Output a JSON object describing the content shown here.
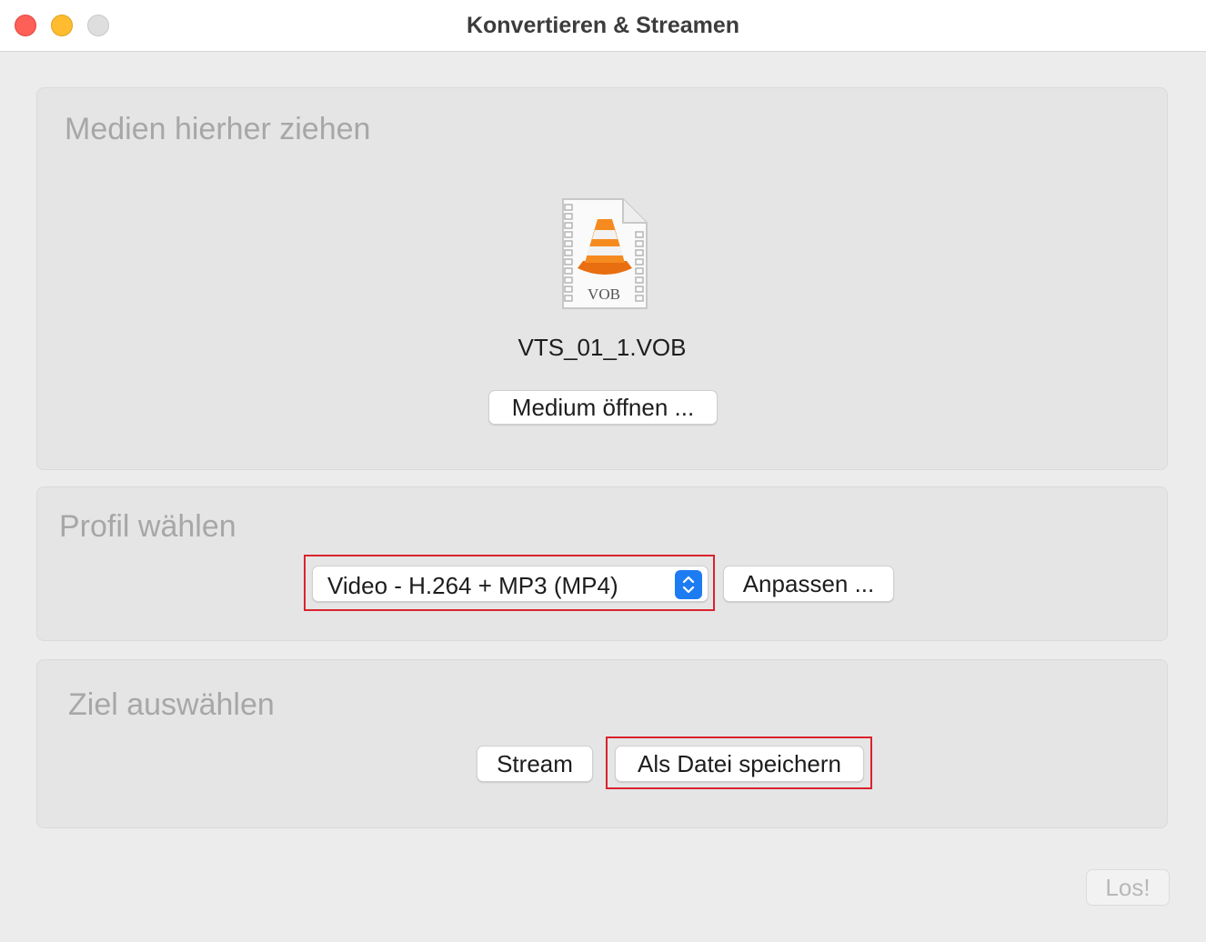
{
  "window": {
    "title": "Konvertieren & Streamen"
  },
  "source": {
    "heading": "Medien hierher ziehen",
    "file_icon_label": "VOB",
    "file_name": "VTS_01_1.VOB",
    "open_button": "Medium öffnen ..."
  },
  "profile": {
    "heading": "Profil wählen",
    "selected": "Video - H.264 + MP3 (MP4)",
    "customize_button": "Anpassen ..."
  },
  "destination": {
    "heading": "Ziel auswählen",
    "stream_button": "Stream",
    "save_button": "Als Datei speichern"
  },
  "footer": {
    "go_button": "Los!"
  },
  "colors": {
    "accent": "#1e7cf2",
    "highlight": "#d9232d",
    "cone": "#f07d1a"
  }
}
